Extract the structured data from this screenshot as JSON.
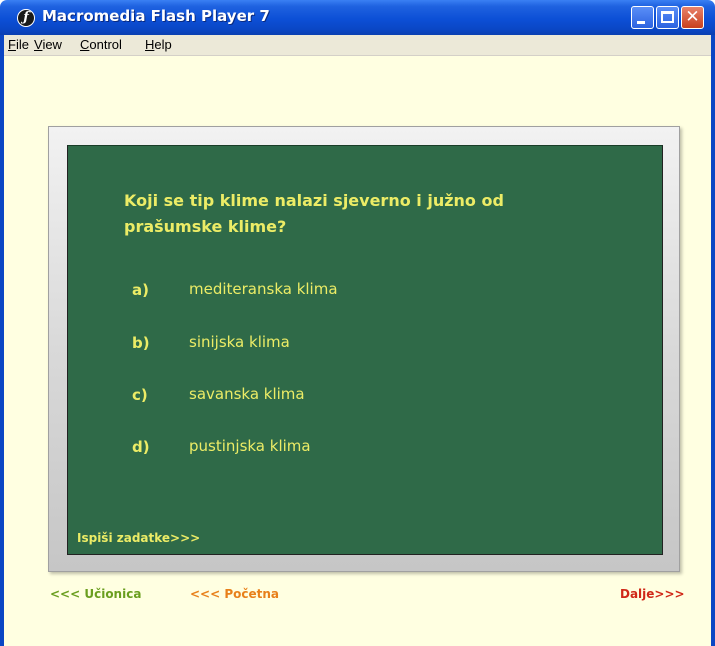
{
  "window": {
    "title": "Macromedia Flash Player 7",
    "app_icon": "flash-icon",
    "controls": {
      "minimize": "_",
      "maximize": "□",
      "close": "✕"
    }
  },
  "menu": {
    "items": [
      {
        "label": "File",
        "key": "F"
      },
      {
        "label": "View",
        "key": "V"
      },
      {
        "label": "Control",
        "key": "C"
      },
      {
        "label": "Help",
        "key": "H"
      }
    ]
  },
  "board": {
    "question_line1": "Koji se tip klime nalazi sjeverno i južno od",
    "question_line2": "prašumske klime?",
    "answers": [
      {
        "letter": "a)",
        "text": "mediteranska klima"
      },
      {
        "letter": "b)",
        "text": "sinijska klima"
      },
      {
        "letter": "c)",
        "text": "savanska klima"
      },
      {
        "letter": "d)",
        "text": "pustinjska klima"
      }
    ],
    "print_link": "Ispiši zadatke>>>"
  },
  "nav": {
    "classroom": "<<< Učionica",
    "home": "<<< Početna",
    "next": "Dalje>>>"
  },
  "colors": {
    "board": "#2f6a48",
    "chalk_text": "#ecec66",
    "classroom_link": "#6a9e1e",
    "home_link": "#e8801a",
    "next_link": "#d02818"
  }
}
